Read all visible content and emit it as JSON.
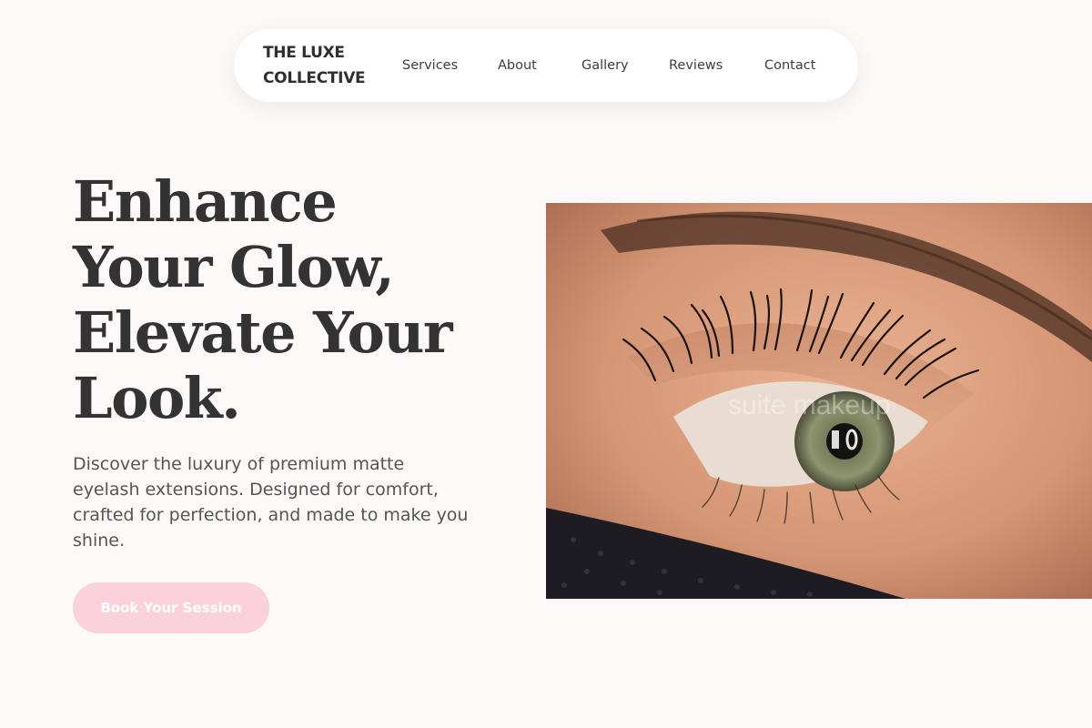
{
  "brand": {
    "line1": "THE LUXE",
    "line2": "COLLECTIVE"
  },
  "nav": {
    "items": [
      {
        "label": "Services"
      },
      {
        "label": "About"
      },
      {
        "label": "Gallery"
      },
      {
        "label": "Reviews"
      },
      {
        "label": "Contact"
      }
    ]
  },
  "hero": {
    "title_lines": [
      "Enhance",
      "Your Glow,",
      "Elevate Your",
      "Look."
    ],
    "description": "Discover the luxury of premium matte eyelash extensions. Designed for comfort, crafted for perfection, and made to make you shine.",
    "cta_label": "Book Your Session",
    "image_watermark": "suite makeup"
  },
  "colors": {
    "background": "#fdf9f8",
    "cta_background": "#fbd1dc",
    "cta_text": "#ffffff",
    "heading": "#333333",
    "body_text": "#555555"
  },
  "icons": []
}
